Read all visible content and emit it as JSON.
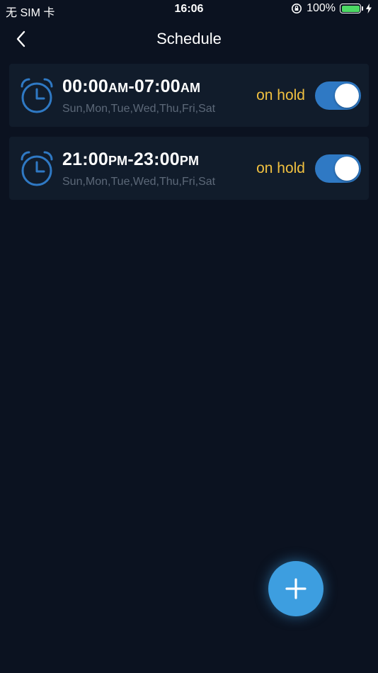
{
  "status_bar": {
    "carrier": "无 SIM 卡",
    "time": "16:06",
    "battery": "100%",
    "battery_level": 1.0,
    "battery_color": "#4cd964",
    "icons": [
      "orientation-lock-icon",
      "battery-icon",
      "charging-bolt-icon"
    ]
  },
  "nav": {
    "title": "Schedule",
    "back_icon": "chevron-left-icon"
  },
  "schedules": [
    {
      "start": "00:00",
      "start_suffix": "AM",
      "separator": "-",
      "end": "07:00",
      "end_suffix": "AM",
      "days": "Sun,Mon,Tue,Wed,Thu,Fri,Sat",
      "status": "on hold",
      "enabled": true,
      "icon": "alarm-clock-icon"
    },
    {
      "start": "21:00",
      "start_suffix": "PM",
      "separator": "-",
      "end": "23:00",
      "end_suffix": "PM",
      "days": "Sun,Mon,Tue,Wed,Thu,Fri,Sat",
      "status": "on hold",
      "enabled": true,
      "icon": "alarm-clock-icon"
    }
  ],
  "fab": {
    "icon": "plus-icon"
  },
  "colors": {
    "background": "#0b1220",
    "card": "#111c2b",
    "accent": "#2f79c4",
    "status_text": "#f0c040",
    "fab": "#3d9ee0",
    "days_text": "#5c6878"
  }
}
